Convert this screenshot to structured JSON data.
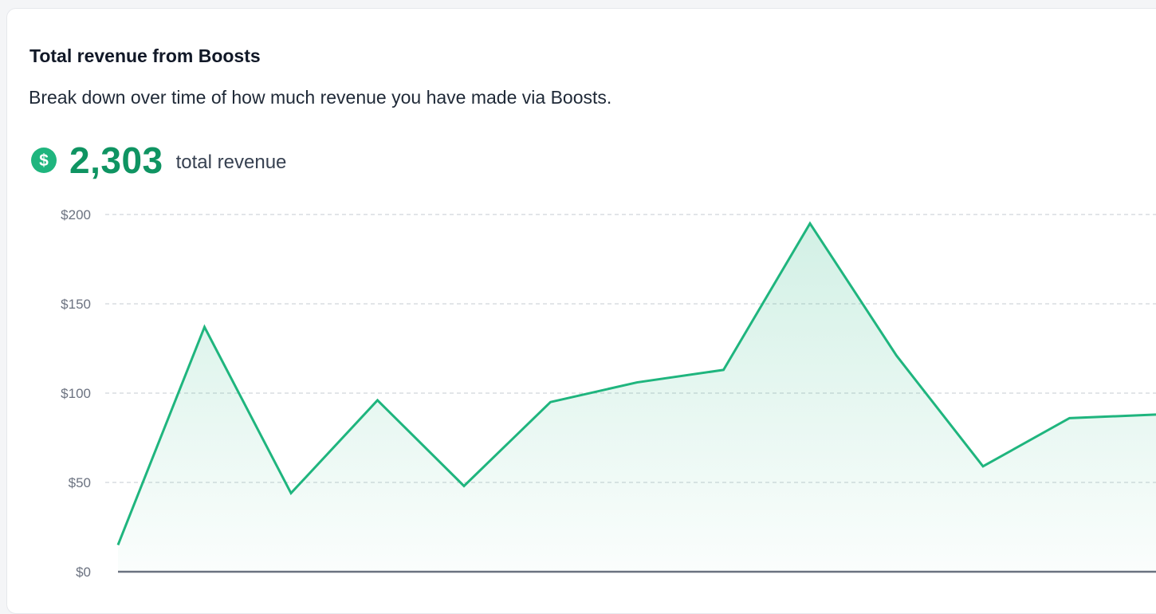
{
  "card": {
    "title": "Total revenue from Boosts",
    "subtitle": "Break down over time of how much revenue you have made via Boosts."
  },
  "stat": {
    "icon": "dollar-circle-icon",
    "value": "2,303",
    "label": "total revenue"
  },
  "colors": {
    "accent": "#1fb57e",
    "accent_text": "#0f9462",
    "axis": "#6b7280",
    "grid": "#d1d5db"
  },
  "chart_data": {
    "type": "area",
    "x": [
      1,
      2,
      3,
      4,
      5,
      6,
      7,
      8,
      9,
      10,
      11,
      12,
      13
    ],
    "series": [
      {
        "values": [
          15,
          137,
          44,
          96,
          48,
          95,
          106,
          113,
          195,
          121,
          59,
          86,
          88
        ]
      }
    ],
    "ylim": [
      0,
      200
    ],
    "yticks": [
      {
        "value": 0,
        "label": "$0"
      },
      {
        "value": 50,
        "label": "$50"
      },
      {
        "value": 100,
        "label": "$100"
      },
      {
        "value": 150,
        "label": "$150"
      },
      {
        "value": 200,
        "label": "$200"
      }
    ],
    "grid": true,
    "legend": "none"
  }
}
